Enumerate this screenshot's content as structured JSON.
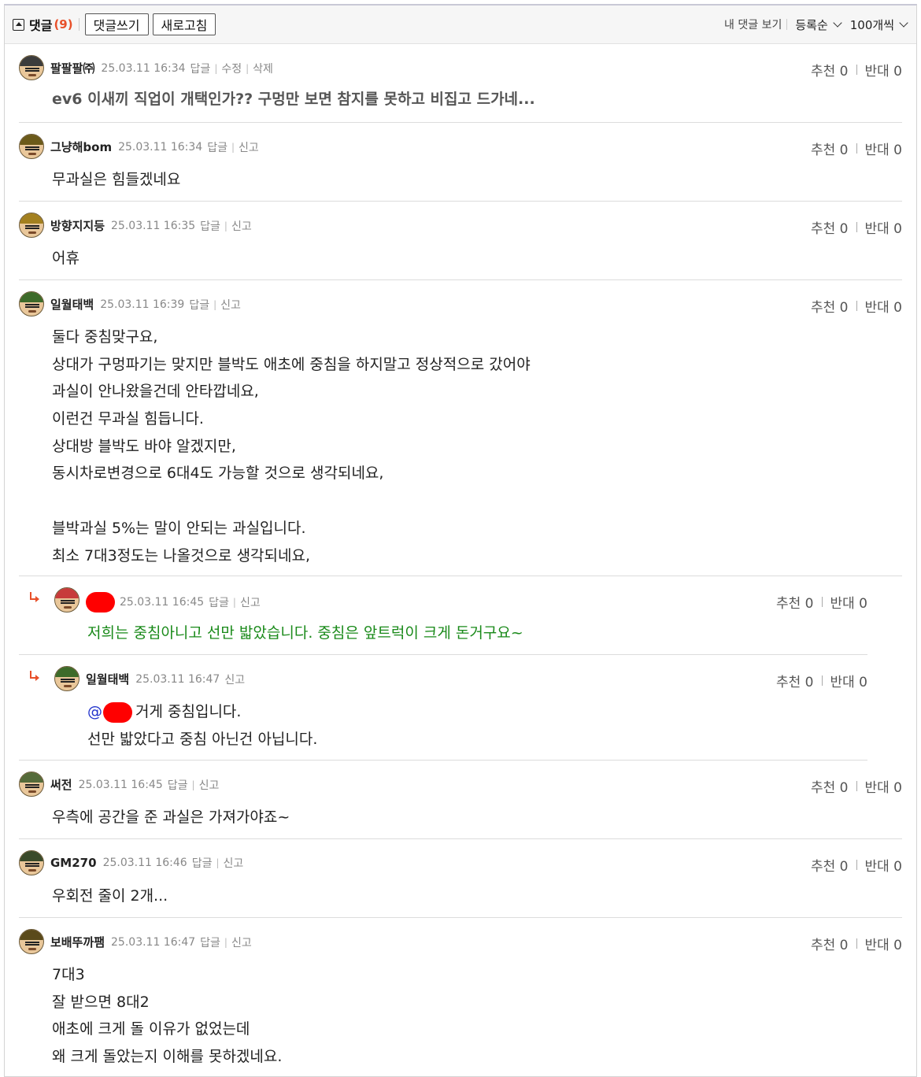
{
  "header": {
    "title": "댓글",
    "count": "(9)",
    "write_label": "댓글쓰기",
    "refresh_label": "새로고침",
    "my_comments_label": "내 댓글 보기",
    "sort_label": "등록순",
    "page_size_label": "100개씩"
  },
  "vote_labels": {
    "up": "추천",
    "down": "반대"
  },
  "comments": [
    {
      "nick": "팔팔팔㈜",
      "date": "25.03.11 16:34",
      "actions": [
        "답글",
        "수정",
        "삭제"
      ],
      "up": "0",
      "down": "0",
      "lines": [
        "ev6 이새끼 직업이 개택인가?? 구멍만 보면 참지를 못하고 비집고 드가네..."
      ]
    },
    {
      "nick": "그냥해bom",
      "date": "25.03.11 16:34",
      "actions": [
        "답글",
        "신고"
      ],
      "up": "0",
      "down": "0",
      "lines": [
        "무과실은 힘들겠네요"
      ]
    },
    {
      "nick": "방향지지등",
      "date": "25.03.11 16:35",
      "actions": [
        "답글",
        "신고"
      ],
      "up": "0",
      "down": "0",
      "lines": [
        "어휴"
      ]
    },
    {
      "nick": "일월태백",
      "date": "25.03.11 16:39",
      "actions": [
        "답글",
        "신고"
      ],
      "up": "0",
      "down": "0",
      "lines": [
        "둘다 중침맞구요,",
        "상대가 구멍파기는 맞지만 블박도 애초에 중침을 하지말고 정상적으로 갔어야",
        "과실이 안나왔을건데 안타깝네요,",
        "이런건 무과실 힘듭니다.",
        "상대방 블박도 바야 알겠지만,",
        "동시차로변경으로 6대4도 가능할 것으로 생각되네요,",
        "",
        "블박과실 5%는 말이 안되는 과실입니다.",
        "최소 7대3정도는 나올것으로 생각되네요,"
      ]
    },
    {
      "nick": "",
      "date": "25.03.11 16:45",
      "actions": [
        "답글",
        "신고"
      ],
      "up": "0",
      "down": "0",
      "lines": [
        "저희는 중침아니고 선만 밟았습니다. 중침은 앞트럭이 크게 돈거구요~"
      ]
    },
    {
      "nick": "일월태백",
      "date": "25.03.11 16:47",
      "actions": [
        "신고"
      ],
      "up": "0",
      "down": "0",
      "mention": "@",
      "lines": [
        "거게 중침입니다.",
        "선만 밟았다고 중침 아닌건 아닙니다."
      ]
    },
    {
      "nick": "써전",
      "date": "25.03.11 16:45",
      "actions": [
        "답글",
        "신고"
      ],
      "up": "0",
      "down": "0",
      "lines": [
        "우측에 공간을 준 과실은 가져가야죠~"
      ]
    },
    {
      "nick": "GM270",
      "date": "25.03.11 16:46",
      "actions": [
        "답글",
        "신고"
      ],
      "up": "0",
      "down": "0",
      "lines": [
        "우회전 줄이 2개..."
      ]
    },
    {
      "nick": "보배뚜까팸",
      "date": "25.03.11 16:47",
      "actions": [
        "답글",
        "신고"
      ],
      "up": "0",
      "down": "0",
      "lines": [
        "7대3",
        "잘 받으면 8대2",
        "애초에 크게 돌 이유가 없었는데",
        "왜 크게 돌았는지 이해를 못하겠네요."
      ]
    }
  ],
  "colors": {
    "accent": "#e8502a",
    "reply_text": "#1a8a1a",
    "mention": "#2233cc",
    "redaction": "#ff0000"
  }
}
